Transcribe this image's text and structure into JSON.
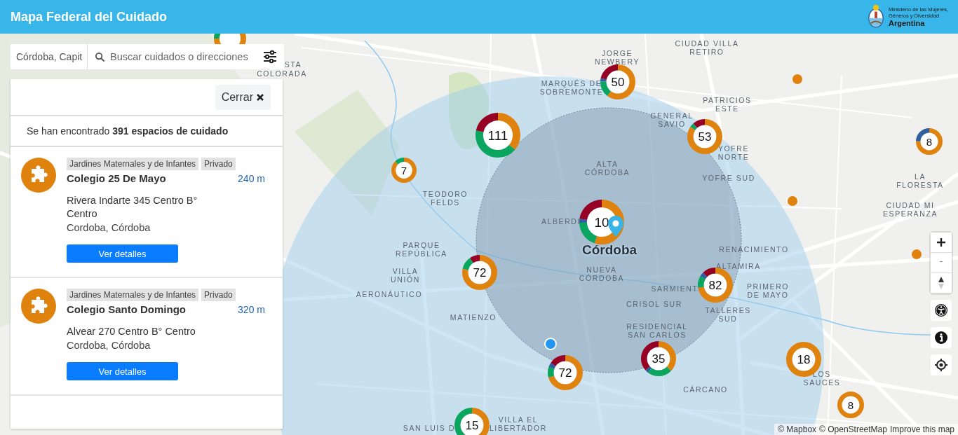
{
  "header": {
    "title": "Mapa Federal del Cuidado",
    "ministry_lines": [
      "Ministerio de las Mujeres,",
      "Géneros y Diversidad"
    ],
    "country": "Argentina"
  },
  "search": {
    "location": "Córdoba, Capit",
    "placeholder": "Buscar cuidados o direcciones"
  },
  "results_panel": {
    "close_label": "Cerrar",
    "summary": "Se han encontrado **391 espacios de cuidado**",
    "results": [
      {
        "category": "Jardines Maternales y de Infantes",
        "sector": "Privado",
        "name": "Colegio 25 De Mayo",
        "distance": "240 m",
        "address": "Rivera Indarte 345 Centro B° Centro",
        "city": "Cordoba, Córdoba",
        "button": "Ver detalles"
      },
      {
        "category": "Jardines Maternales y de Infantes",
        "sector": "Privado",
        "name": "Colegio Santo Domingo",
        "distance": "320 m",
        "address": "Alvear 270 Centro B° Centro",
        "city": "Cordoba, Córdoba",
        "button": "Ver detalles"
      }
    ]
  },
  "map": {
    "city_label": "Córdoba",
    "place_labels": [
      "JORGE\nNEWBERY",
      "CIUDAD VILLA\nRETIRO",
      "STA",
      "COLORADA",
      "MARQUÉS DE\nSOBREMONTE",
      "PATRICIOS\nESTE",
      "GENERAL\nSAVIO",
      "YOFRE\nNORTE",
      "ALTA\nCÓRDOBA",
      "YOFRE SUD",
      "LA\nFLORESTA",
      "TEODORO\nFELDS",
      "CIUDAD MI\nESPERANZA",
      "ALBERDI",
      "PARQUE\nREPÚBLICA",
      "RENACIMIENTO",
      "VILLA\nUNIÓN",
      "NUEVA\nCÓRDOBA",
      "ALTAMIRA",
      "AERONÁUTICO",
      "SARMIENT",
      "PRIMERO\nDE MAYO",
      "MATIENZO",
      "CRISOL SUR",
      "TALLERES\nSUD",
      "RESIDENCIAL\nSAN CARLOS",
      "LOS\nSAUCES",
      "CÁRCANO",
      "SAN LUIS D",
      "VILLA EL\nLIBERTADOR"
    ],
    "clusters": [
      {
        "count": "50"
      },
      {
        "count": "111"
      },
      {
        "count": "7"
      },
      {
        "count": "53"
      },
      {
        "count": "8"
      },
      {
        "count": "10"
      },
      {
        "count": "72"
      },
      {
        "count": "82"
      },
      {
        "count": "72"
      },
      {
        "count": "35"
      },
      {
        "count": "18"
      },
      {
        "count": "8"
      },
      {
        "count": "15"
      }
    ],
    "attribution": [
      "© Mapbox",
      "© OpenStreetMap",
      "Improve this map"
    ]
  }
}
